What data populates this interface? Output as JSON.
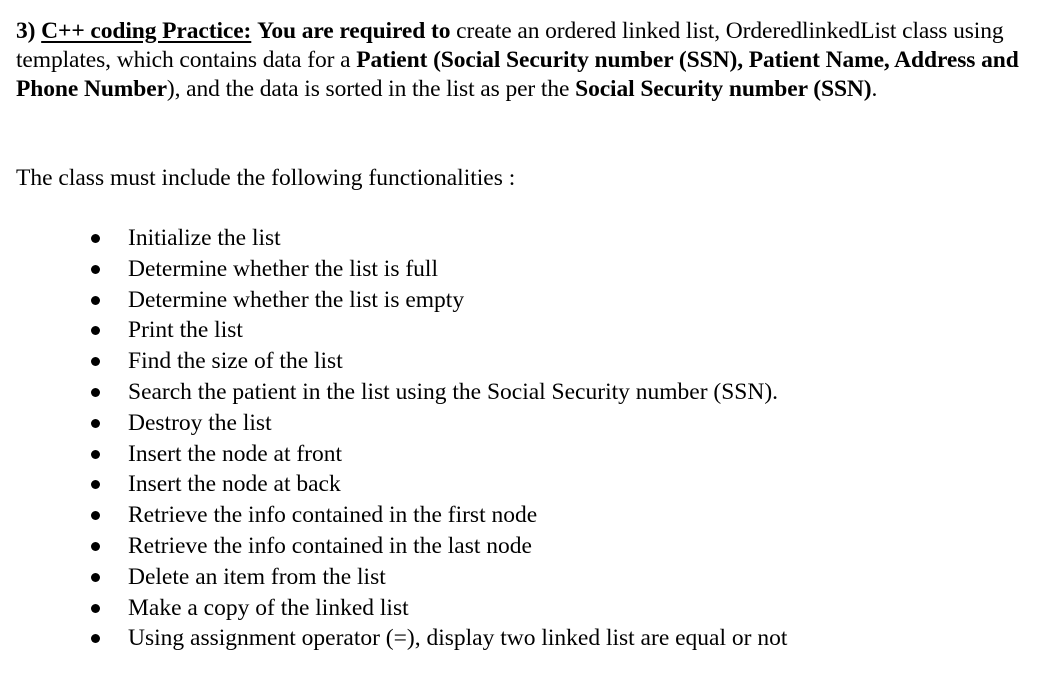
{
  "question": {
    "number": "3)",
    "title": "C++ coding Practice:",
    "lead_bold": "You are required to",
    "text_1": " create an ordered linked list, OrderedlinkedList class using templates, which contains data for a ",
    "bold_1": "Patient (Social Security number (SSN), Patient Name, Address and Phone Number",
    "text_2": "), and the data is sorted in the list as per the ",
    "bold_2": "Social Security number (SSN)",
    "text_3": "."
  },
  "intro": "The class must include the following functionalities :",
  "functionalities": [
    "Initialize the list",
    "Determine whether the list is full",
    "Determine whether the list is empty",
    "Print the list",
    "Find the size of the list",
    "Search the patient in the list using the Social Security number (SSN).",
    "Destroy the list",
    "Insert the node at front",
    "Insert the node at back",
    "Retrieve the info contained in the first node",
    "Retrieve the info contained in the last node",
    "Delete an item from the list",
    "Make a copy of the linked list",
    "Using assignment operator (=), display two linked list are equal or not"
  ]
}
